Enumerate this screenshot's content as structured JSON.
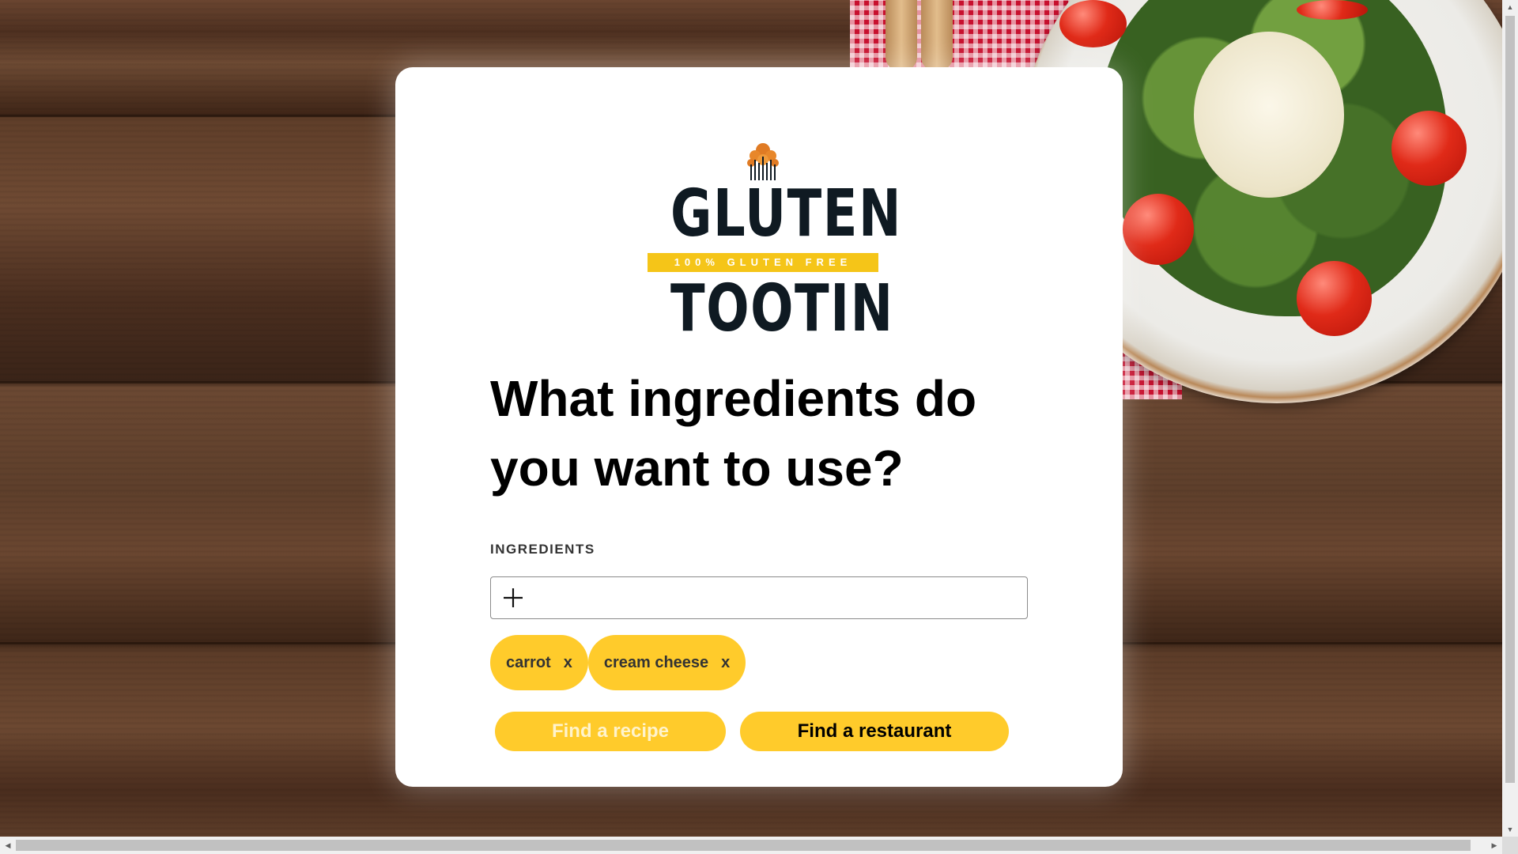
{
  "brand": {
    "name_top": "GLUTEN",
    "tagline": "100% GLUTEN FREE",
    "name_bottom": "TOOTIN",
    "colors": {
      "band": "#f5c518",
      "wordmark": "#0f1a22",
      "mark": "#e07b24"
    }
  },
  "headline": "What ingredients do you want to use?",
  "ingredients": {
    "label": "INGREDIENTS",
    "input_value": "",
    "add_icon": "plus-icon",
    "tags": [
      {
        "label": "carrot",
        "remove_label": "x"
      },
      {
        "label": "cream cheese",
        "remove_label": "x"
      }
    ]
  },
  "actions": {
    "find_recipe_label": "Find a recipe",
    "find_restaurant_label": "Find a restaurant"
  },
  "theme": {
    "accent": "#ffcb2b",
    "card_background": "#ffffff"
  },
  "scrollbars": {
    "up_arrow": "▲",
    "down_arrow": "▼",
    "left_arrow": "◀",
    "right_arrow": "▶"
  }
}
